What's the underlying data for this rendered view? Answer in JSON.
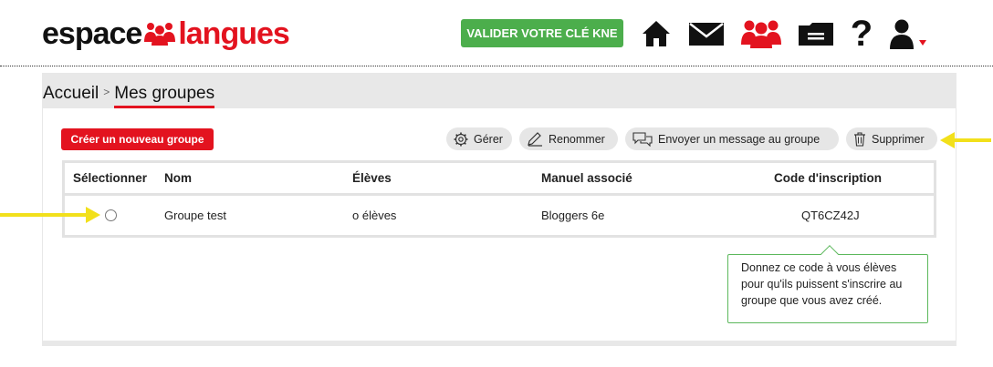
{
  "header": {
    "logo_part1": "espace",
    "logo_part2": "langues",
    "kne_button": "VALIDER VOTRE CLÉ KNE",
    "icons": [
      "home-icon",
      "mail-icon",
      "groups-icon",
      "folder-icon",
      "help-icon",
      "user-icon"
    ]
  },
  "breadcrumb": {
    "home": "Accueil",
    "separator": ">",
    "current": "Mes groupes"
  },
  "toolbar": {
    "create_label": "Créer un nouveau groupe",
    "manage_label": "Gérer",
    "rename_label": "Renommer",
    "message_label": "Envoyer un message au groupe",
    "delete_label": "Supprimer"
  },
  "table": {
    "columns": [
      "Sélectionner",
      "Nom",
      "Élèves",
      "Manuel associé",
      "Code d'inscription"
    ],
    "rows": [
      {
        "name": "Groupe test",
        "students": "o élèves",
        "manual": "Bloggers 6e",
        "code": "QT6CZ42J"
      }
    ]
  },
  "tooltip": {
    "text": "Donnez ce code à vous élèves pour qu'ils puissent s'inscrire au groupe que vous avez créé."
  },
  "colors": {
    "brand_red": "#e3131f",
    "kne_green": "#4cae4c",
    "arrow_yellow": "#f2e01b"
  }
}
